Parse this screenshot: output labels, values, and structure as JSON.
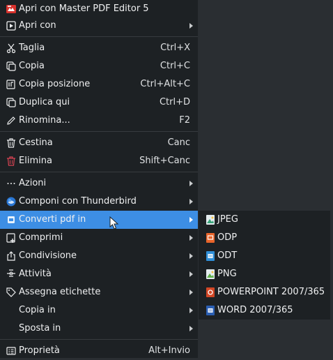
{
  "menu": {
    "items": [
      {
        "label": "Apri con Master PDF Editor 5",
        "shortcut": "",
        "icon": "master-pdf-icon"
      },
      {
        "label": "Apri con",
        "shortcut": "",
        "icon": "open-with-icon"
      },
      {
        "label": "Taglia",
        "shortcut": "Ctrl+X",
        "icon": "scissors-icon"
      },
      {
        "label": "Copia",
        "shortcut": "Ctrl+C",
        "icon": "copy-icon"
      },
      {
        "label": "Copia posizione",
        "shortcut": "Ctrl+Alt+C",
        "icon": "copy-path-icon"
      },
      {
        "label": "Duplica qui",
        "shortcut": "Ctrl+D",
        "icon": "duplicate-icon"
      },
      {
        "label": "Rinomina...",
        "shortcut": "F2",
        "icon": "pencil-icon"
      },
      {
        "label": "Cestina",
        "shortcut": "Canc",
        "icon": "trash-icon"
      },
      {
        "label": "Elimina",
        "shortcut": "Shift+Canc",
        "icon": "delete-icon"
      },
      {
        "label": "Azioni",
        "shortcut": "",
        "icon": "ellipsis-icon"
      },
      {
        "label": "Componi con Thunderbird",
        "shortcut": "",
        "icon": "thunderbird-icon"
      },
      {
        "label": "Converti pdf in",
        "shortcut": "",
        "icon": "convert-icon"
      },
      {
        "label": "Comprimi",
        "shortcut": "",
        "icon": "compress-icon"
      },
      {
        "label": "Condivisione",
        "shortcut": "",
        "icon": "share-icon"
      },
      {
        "label": "Attività",
        "shortcut": "",
        "icon": "activities-icon"
      },
      {
        "label": "Assegna etichette",
        "shortcut": "",
        "icon": "tag-icon"
      },
      {
        "label": "Copia in",
        "shortcut": "",
        "icon": ""
      },
      {
        "label": "Sposta in",
        "shortcut": "",
        "icon": ""
      },
      {
        "label": "Proprietà",
        "shortcut": "Alt+Invio",
        "icon": "properties-icon"
      }
    ]
  },
  "submenu": {
    "items": [
      {
        "label": "JPEG",
        "icon": "image-file-icon"
      },
      {
        "label": "ODP",
        "icon": "presentation-file-icon"
      },
      {
        "label": "ODT",
        "icon": "text-document-icon"
      },
      {
        "label": "PNG",
        "icon": "image-file-icon"
      },
      {
        "label": "POWERPOINT 2007/365",
        "icon": "powerpoint-file-icon"
      },
      {
        "label": "WORD 2007/365",
        "icon": "word-file-icon"
      }
    ]
  },
  "colors": {
    "menu_bg": "#1d2124",
    "highlight": "#3d8ee4",
    "text": "#eff0f1",
    "separator": "#373b3f",
    "danger": "#da4453"
  }
}
